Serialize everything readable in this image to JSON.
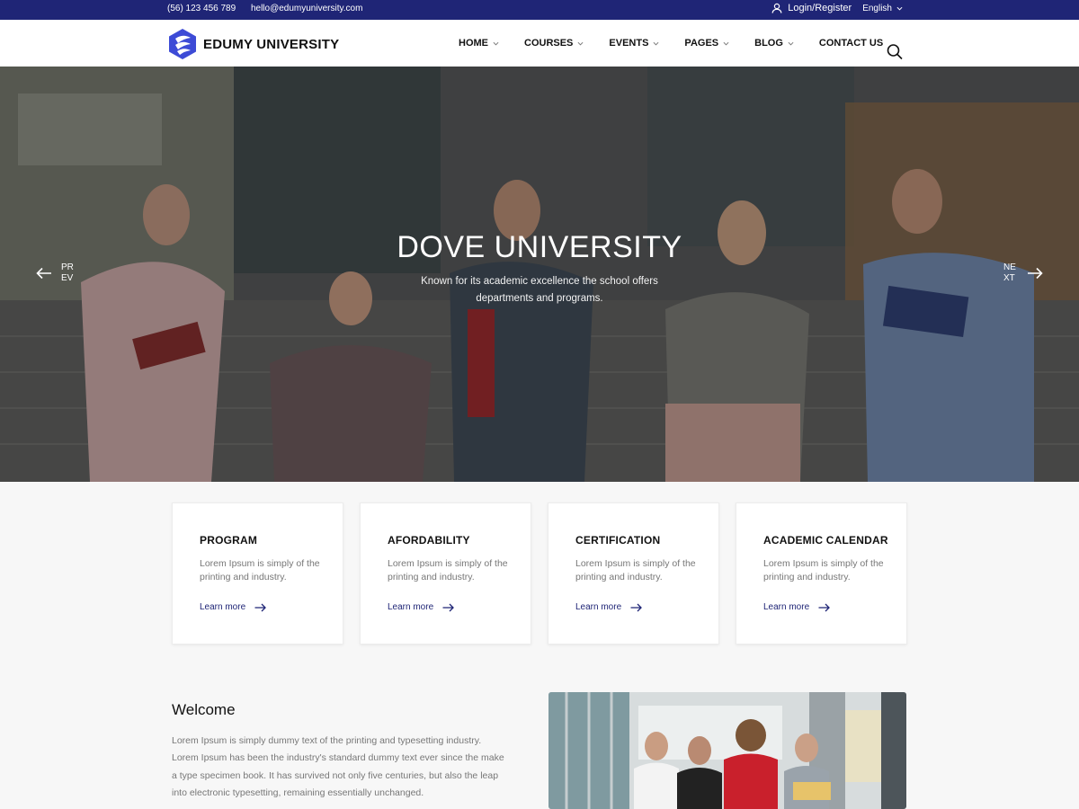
{
  "topbar": {
    "phone": "(56) 123 456 789",
    "email": "hello@edumyuniversity.com",
    "login_label": "Login/Register",
    "language": "English"
  },
  "header": {
    "brand": "EDUMY UNIVERSITY",
    "nav": [
      {
        "label": "HOME",
        "has_dropdown": true
      },
      {
        "label": "COURSES",
        "has_dropdown": true
      },
      {
        "label": "EVENTS",
        "has_dropdown": true
      },
      {
        "label": "PAGES",
        "has_dropdown": true
      },
      {
        "label": "BLOG",
        "has_dropdown": true
      },
      {
        "label": "CONTACT US",
        "has_dropdown": false
      }
    ],
    "search_icon": "search-icon"
  },
  "hero": {
    "title": "DOVE UNIVERSITY",
    "subtitle": "Known for its academic excellence the school offers departments and programs.",
    "prev_label": "PREV",
    "next_label": "NEXT"
  },
  "features": [
    {
      "title": "PROGRAM",
      "text": "Lorem Ipsum is simply of the printing and industry.",
      "link": "Learn more"
    },
    {
      "title": "AFORDABILITY",
      "text": "Lorem Ipsum is simply of the printing and industry.",
      "link": "Learn more"
    },
    {
      "title": "CERTIFICATION",
      "text": "Lorem Ipsum is simply of the printing and industry.",
      "link": "Learn more"
    },
    {
      "title": "ACADEMIC CALENDAR",
      "text": "Lorem Ipsum is simply of the printing and industry.",
      "link": "Learn more"
    }
  ],
  "welcome": {
    "heading": "Welcome",
    "body": "Lorem Ipsum is simply dummy text of the printing and typesetting industry. Lorem Ipsum has been the industry's standard dummy text ever since the make a type specimen book. It has survived not only five centuries, but also the leap into electronic typesetting, remaining essentially unchanged."
  },
  "colors": {
    "primary": "#1f2576",
    "accent": "#3d4bd6"
  }
}
